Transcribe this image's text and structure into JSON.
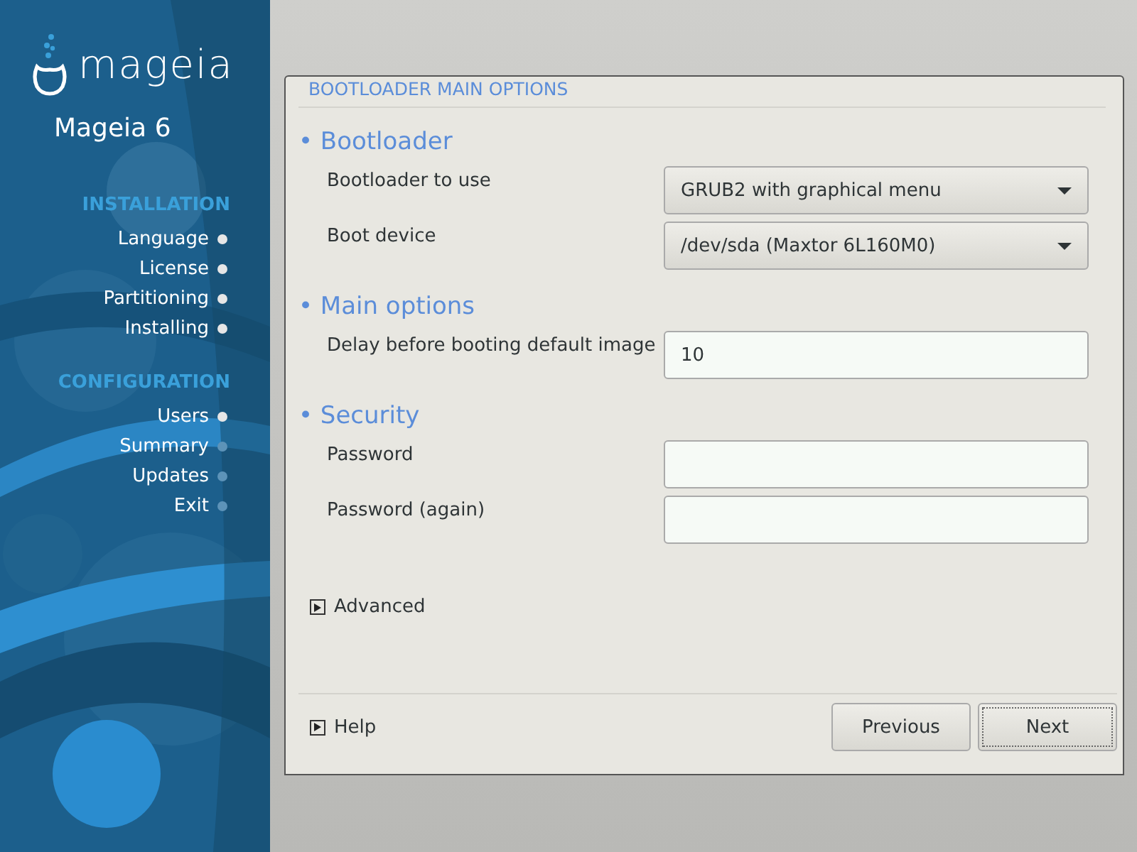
{
  "sidebar": {
    "logo_text": "mageia",
    "version": "Mageia 6",
    "sections": [
      {
        "title": "INSTALLATION",
        "steps": [
          {
            "label": "Language",
            "done": true
          },
          {
            "label": "License",
            "done": true
          },
          {
            "label": "Partitioning",
            "done": true
          },
          {
            "label": "Installing",
            "done": true
          }
        ]
      },
      {
        "title": "CONFIGURATION",
        "steps": [
          {
            "label": "Users",
            "done": true
          },
          {
            "label": "Summary",
            "done": false
          },
          {
            "label": "Updates",
            "done": false
          },
          {
            "label": "Exit",
            "done": false
          }
        ]
      }
    ]
  },
  "dialog": {
    "title": "BOOTLOADER MAIN OPTIONS",
    "groups": [
      {
        "heading": "• Bootloader",
        "rows": [
          {
            "label": "Bootloader to use",
            "kind": "dropdown",
            "value": "GRUB2 with graphical menu"
          },
          {
            "label": "Boot device",
            "kind": "dropdown",
            "value": "/dev/sda (Maxtor 6L160M0)"
          }
        ]
      },
      {
        "heading": "• Main options",
        "rows": [
          {
            "label": "Delay before booting default image",
            "kind": "entry",
            "value": "10"
          }
        ]
      },
      {
        "heading": "• Security",
        "rows": [
          {
            "label": "Password",
            "kind": "password"
          },
          {
            "label": "Password (again)",
            "kind": "password"
          }
        ]
      }
    ],
    "advanced": {
      "label": "Advanced",
      "expanded": false
    },
    "help": {
      "label": "Help",
      "expanded": false
    },
    "buttons": [
      {
        "label": "Previous",
        "focused": false
      },
      {
        "label": "Next",
        "focused": true
      }
    ]
  }
}
